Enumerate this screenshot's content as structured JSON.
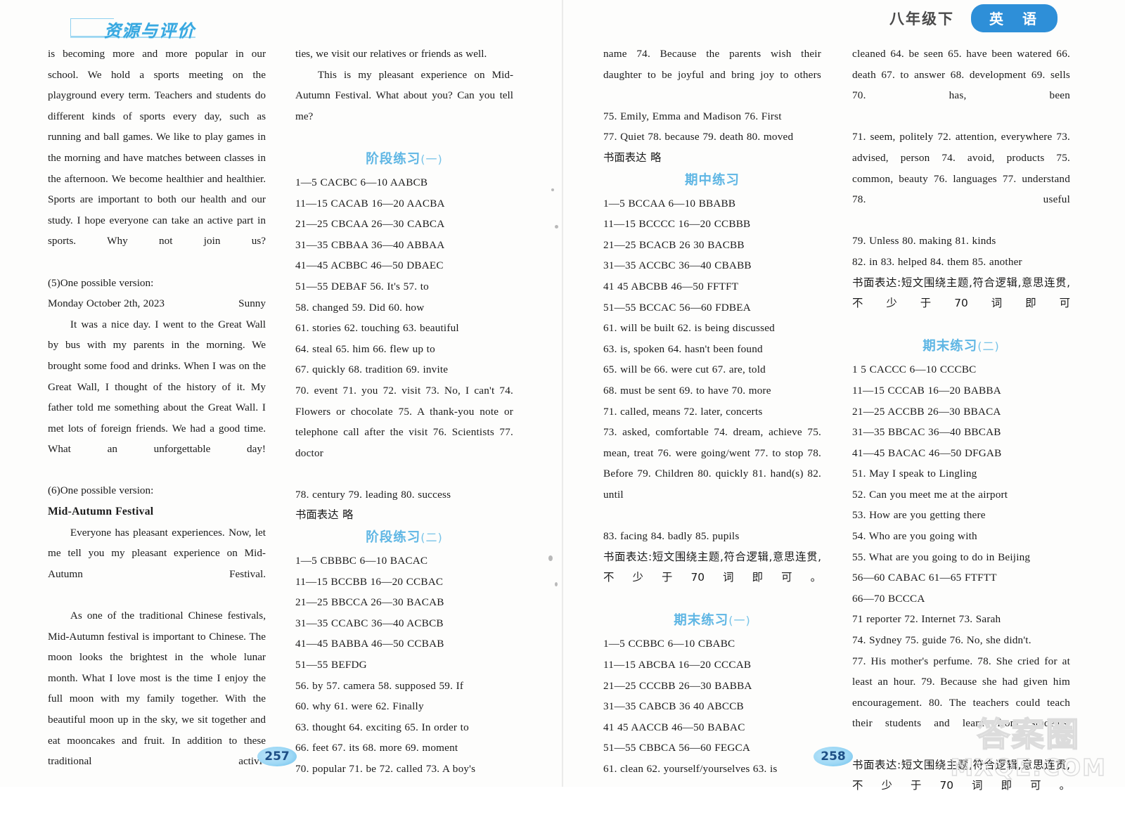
{
  "header": {
    "logo_text": "资源与评价",
    "arrow": "·· ▸",
    "grade": "八年级下",
    "subject": "英 语"
  },
  "watermark": {
    "cjk": "答案圈",
    "domain": "MXQE.COM"
  },
  "page_numbers": {
    "left": "257",
    "right": "258"
  },
  "col1": {
    "para_sports": "is becoming more and more popular in our school. We hold a sports meeting on the playground every term. Teachers and students do different kinds of sports every day, such as running and ball games. We like to play games in the morning and have matches between classes in the afternoon. We become healthier and healthier. Sports are important to both our health and our study. I hope everyone can take an active part in sports. Why not join us?",
    "label_5": "(5)One possible version:",
    "date": "Monday October 2th, 2023",
    "weather": "Sunny",
    "para_greatwall": "It was a nice day. I went to the Great Wall by bus with my parents in the morning. We brought some food and drinks. When I was on the Great Wall, I thought of the history of it. My father told me something about the Great Wall. I met lots of foreign friends. We had a good time. What an unforgettable day!",
    "label_6": "(6)One possible version:",
    "title_midautumn": "Mid-Autumn Festival",
    "para_mid1": "Everyone has pleasant experiences. Now, let me tell you my pleasant experience on Mid-Autumn Festival.",
    "para_mid2": "As one of the traditional Chinese festivals, Mid-Autumn festival is important to Chinese. The moon looks the brightest in the whole lunar month. What I love most is the time I enjoy the full moon with my family together. With the beautiful moon up in the sky, we sit together and eat mooncakes and fruit. In addition to these traditional activi-"
  },
  "col2": {
    "para_cont": "ties, we visit our relatives or friends as well.",
    "para_mid3": "This is my pleasant experience on Mid-Autumn Festival. What about you? Can you tell me?",
    "heading1": "阶段练习",
    "heading1_paren": "(一)",
    "lines1": [
      "1—5 CACBC    6—10 AABCB",
      "11—15 CACAB    16—20 AACBA",
      "21—25 CBCAA    26—30 CABCA",
      "31—35 CBBAA    36—40 ABBAA",
      "41—45 ACBBC    46—50 DBAEC",
      "51—55 DEBAF    56. It's    57. to",
      "58. changed    59. Did    60. how",
      "61. stories    62. touching    63. beautiful",
      "64. steal    65. him    66. flew up to",
      "67. quickly    68. tradition    69. invite",
      "70. event    71. you    72. visit    73. No, I can't    74. Flowers or chocolate    75. A thank-you note or telephone call after the visit    76. Scientists    77. doctor",
      "78. century    79. leading    80. success"
    ],
    "written1": "书面表达  略",
    "heading2": "阶段练习",
    "heading2_paren": "(二)",
    "lines2": [
      "1—5 CBBBC    6—10 BACAC",
      "11—15 BCCBB    16—20 CCBAC",
      "21—25 BBCCA    26—30 BACAB",
      "31—35 CCABC    36—40 ACBCB",
      "41—45 BABBA    46—50 CCBAB",
      "51—55 BEFDG",
      "56. by    57. camera    58. supposed    59. If",
      "60. why        61.  were        62.  Finally",
      "63. thought    64. exciting    65. In order to",
      "66. feet    67. its    68. more    69. moment",
      "70. popular    71. be    72. called    73. A boy's"
    ]
  },
  "col3": {
    "cont_lines": [
      "name    74. Because the parents wish their daughter to be joyful and bring joy to others",
      "75. Emily, Emma and Madison    76. First",
      "77. Quiet  78. because    79. death    80. moved"
    ],
    "written_top": "书面表达  略",
    "heading_mid": "期中练习",
    "lines_mid": [
      "1—5 BCCAA    6—10 BBABB",
      "11—15 BCCCC    16—20 CCBBB",
      "21—25 BCACB    26  30 BACBB",
      "31—35 ACCBC    36—40 CBABB",
      "41  45 ABCBB    46—50 FFTFT",
      "51—55 BCCAC    56—60 FDBEA",
      "61. will be built    62. is being discussed",
      "63. is, spoken    64. hasn't been found",
      "65. will be    66. were cut    67. are, told",
      "68. must be sent    69. to have    70. more",
      "71. called, means    72. later, concerts",
      "73. asked, comfortable        74. dream, achieve    75. mean, treat    76. were going/went    77. to stop    78. Before    79. Children    80. quickly    81. hand(s)    82. until",
      "83. facing    84. badly    85. pupils"
    ],
    "written_mid": "书面表达:短文围绕主题,符合逻辑,意思连贯,不少于70词即可。",
    "heading_final1": "期末练习",
    "heading_final1_paren": "(一)",
    "lines_final1": [
      "1—5 CCBBC    6—10 CBABC",
      "11—15 ABCBA    16—20 CCCAB",
      "21—25 CCCBB    26—30 BABBA",
      "31—35 CABCB    36  40 ABCCB",
      "41  45 AACCB    46—50 BABAC",
      "51—55 CBBCA    56—60 FEGCA",
      "61. clean    62. yourself/yourselves    63. is"
    ]
  },
  "col4": {
    "cont_lines": [
      "cleaned    64. be seen    65. have been watered    66. death    67. to answer    68. development    69. sells    70. has, been",
      "71. seem, politely        72. attention, everywhere    73. advised, person    74. avoid, products    75. common, beauty    76. languages    77. understand    78. useful",
      "79. Unless      80. making      81. kinds",
      "82. in  83. helped    84. them  85. another"
    ],
    "written_top": "书面表达:短文围绕主题,符合逻辑,意思连贯,不少于70词即可",
    "heading_final2": "期末练习",
    "heading_final2_paren": "(二)",
    "lines_final2": [
      "1  5 CACCC    6—10 CCCBC",
      "11—15 CCCAB    16—20 BABBA",
      "21—25 ACCBB    26—30 BBACA",
      "31—35 BBCAC    36—40 BBCAB",
      "41—45 BACAC    46—50 DFGAB",
      "51. May I speak to Lingling",
      "52. Can you meet me at the airport",
      "53. How are you getting there",
      "54. Who are you going with",
      "55. What are you going to do in Beijing",
      "56—60 CABAC    61—65 FTFTT",
      "66—70 BCCCA",
      "71 reporter    72. Internet    73. Sarah",
      "74. Sydney    75. guide    76. No, she didn't.",
      "77. His mother's perfume.      78. She cried for at least an hour.    79. Because she had given him encouragement.      80. The teachers could teach their students and learn from students."
    ],
    "written_bottom": "书面表达:短文围绕主题,符合逻辑,意思连贯,不少于70词即可。"
  }
}
